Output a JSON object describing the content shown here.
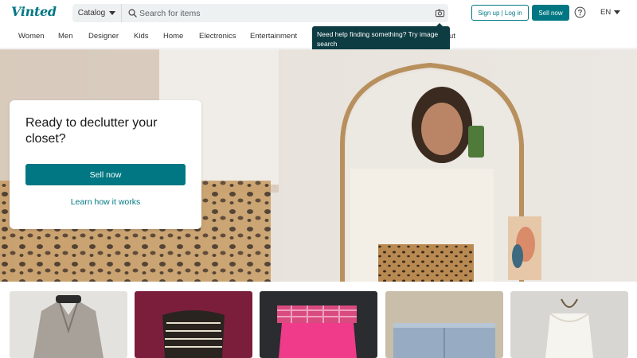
{
  "header": {
    "logo": "Vinted",
    "catalog_label": "Catalog",
    "search_placeholder": "Search for items",
    "signup_login_label": "Sign up | Log in",
    "sell_now_label": "Sell now",
    "language_label": "EN"
  },
  "tooltip": {
    "text": "Need help finding something? Try image search"
  },
  "nav": {
    "items": [
      {
        "label": "Women"
      },
      {
        "label": "Men"
      },
      {
        "label": "Designer"
      },
      {
        "label": "Kids"
      },
      {
        "label": "Home"
      },
      {
        "label": "Electronics"
      },
      {
        "label": "Entertainment"
      },
      {
        "label": "ut"
      }
    ]
  },
  "hero": {
    "title": "Ready to declutter your closet?",
    "sell_button_label": "Sell now",
    "learn_link_label": "Learn how it works"
  },
  "items": [
    {
      "icon": "grey-coat-photo"
    },
    {
      "icon": "striped-top-photo"
    },
    {
      "icon": "pink-plaid-skirt-photo"
    },
    {
      "icon": "denim-jeans-photo"
    },
    {
      "icon": "white-lace-top-photo"
    }
  ],
  "colors": {
    "brand": "#007782",
    "tooltip_bg": "#0e3c43",
    "search_bg": "#eef1f2"
  }
}
